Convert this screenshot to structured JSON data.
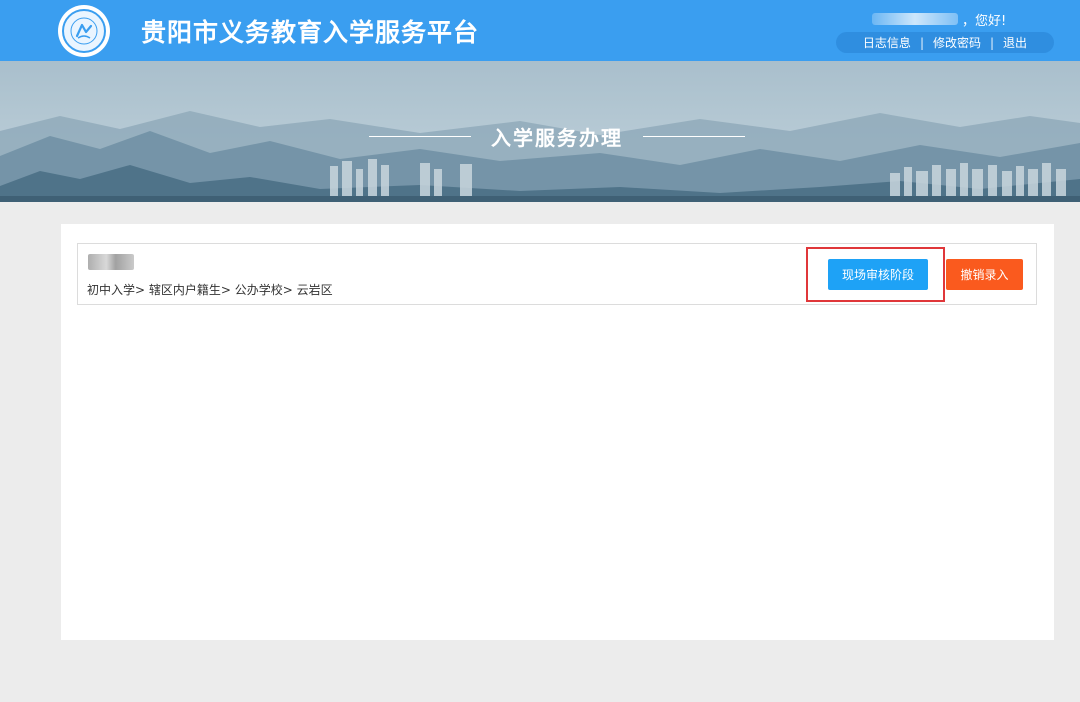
{
  "header": {
    "title": "贵阳市义务教育入学服务平台",
    "greeting": "，您好!",
    "links": [
      "日志信息",
      "修改密码",
      "退出"
    ],
    "separator": "|",
    "brand_color": "#3a9ef0"
  },
  "banner": {
    "title": "入学服务办理"
  },
  "record": {
    "path": "初中入学> 辖区内户籍生> 公办学校> 云岩区",
    "stage_button": "现场审核阶段",
    "cancel_button": "撤销录入",
    "stage_color": "#1ea2f6",
    "cancel_color": "#fa5a1e",
    "highlight_color": "#e0373a"
  },
  "icons": {
    "logo": "education-emblem-icon"
  }
}
